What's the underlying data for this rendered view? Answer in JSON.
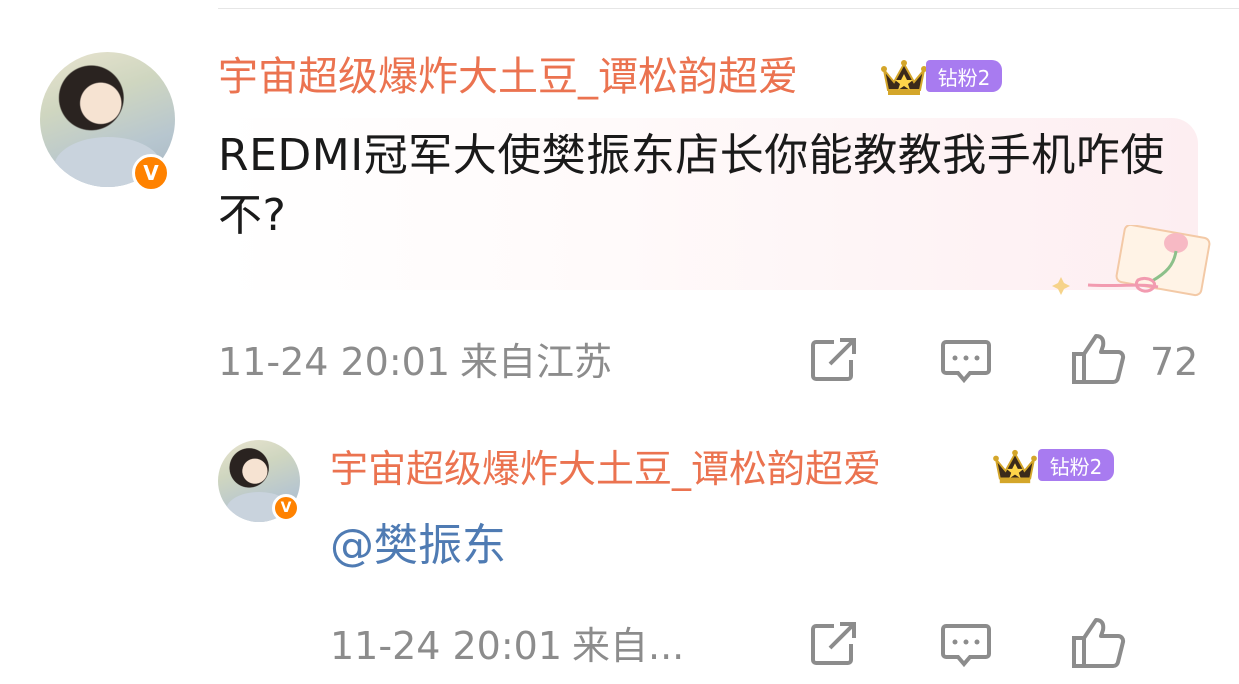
{
  "comment": {
    "username": "宇宙超级爆炸大土豆_谭松韵超爱",
    "fan_badge": "钻粉2",
    "verified_badge": "V",
    "text": "REDMI冠军大使樊振东店长你能教教我手机咋使不?",
    "date": "11-24 20:01",
    "location": "来自江苏",
    "like_count": "72",
    "icons": [
      "share-icon",
      "comment-icon",
      "like-icon"
    ]
  },
  "reply": {
    "username": "宇宙超级爆炸大土豆_谭松韵超爱",
    "fan_badge": "钻粉2",
    "verified_badge": "V",
    "mention": "@樊振东",
    "date": "11-24 20:01",
    "location": "来自...",
    "icons": [
      "share-icon",
      "comment-icon",
      "like-icon"
    ]
  },
  "colors": {
    "username": "#eb7350",
    "mention": "#4f7bb3",
    "meta": "#8c8c8c",
    "verified": "#ff8200",
    "fan_badge": "#a87bf0"
  }
}
